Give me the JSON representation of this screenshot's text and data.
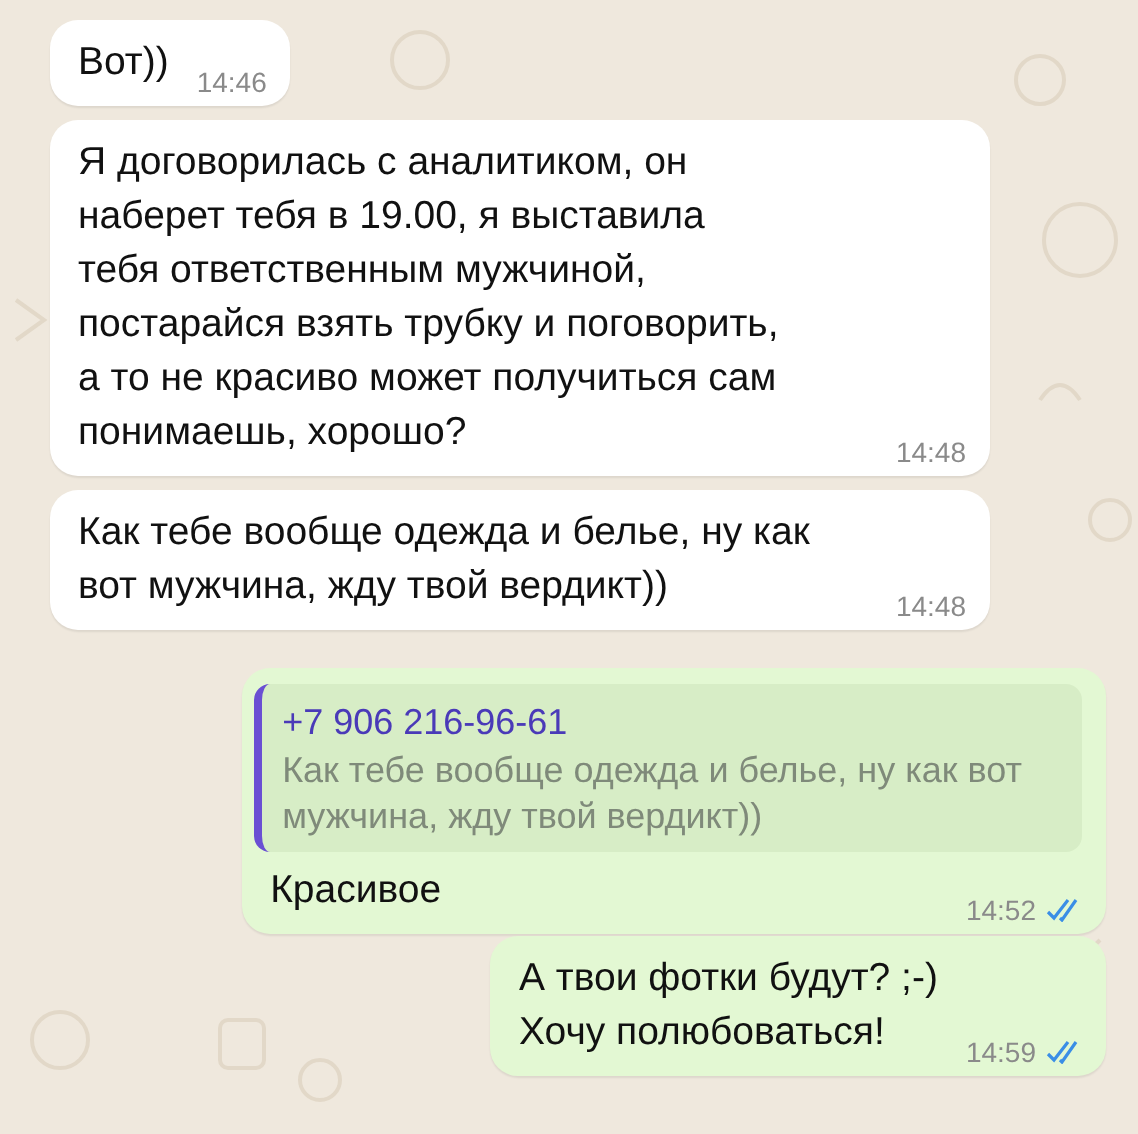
{
  "messages": [
    {
      "kind": "incoming",
      "text": "Вот))",
      "time": "14:46"
    },
    {
      "kind": "incoming",
      "text": "Я договорилась с аналитиком, он\nнаберет тебя в 19.00, я выставила\nтебя ответственным мужчиной,\nпостарайся взять трубку и поговорить,\nа то не красиво может получиться сам\nпонимаешь, хорошо?",
      "time": "14:48"
    },
    {
      "kind": "incoming",
      "text": "Как тебе вообще одежда и белье, ну как\nвот мужчина, жду твой вердикт))",
      "time": "14:48"
    },
    {
      "kind": "outgoing",
      "quote": {
        "author": "+7 906 216-96-61",
        "text": "Как тебе вообще одежда и белье, ну как вот\nмужчина, жду твой вердикт))"
      },
      "text": "Красивое",
      "time": "14:52",
      "read": true
    },
    {
      "kind": "outgoing",
      "text": "А твои фотки будут? ;-)\nХочу полюбоваться!",
      "time": "14:59",
      "read": true
    }
  ]
}
